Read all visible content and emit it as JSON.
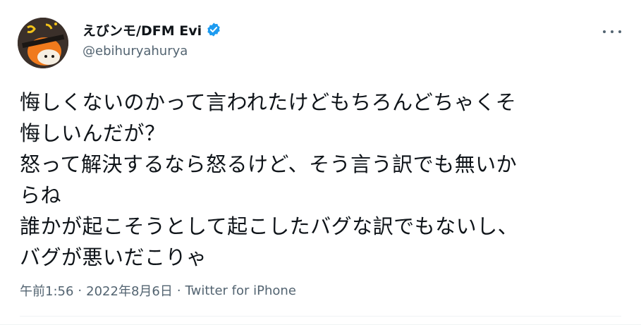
{
  "author": {
    "display_name": "えびンモ/DFM Evi",
    "handle": "@ebihuryahurya",
    "verified": true,
    "avatar_icon": "avatar-icon"
  },
  "tweet": {
    "lines": [
      "悔しくないのかって言われたけどもちろんどちゃくそ",
      "悔しいんだが？",
      "怒って解決するなら怒るけど、そう言う訳でも無いか",
      "らね",
      "誰かが起こそうとして起こしたバグな訳でもないし、",
      "バグが悪いだこりゃ"
    ]
  },
  "meta": {
    "time": "午前1:56",
    "separator": "·",
    "date": "2022年8月6日",
    "source": "Twitter for iPhone"
  },
  "colors": {
    "text_primary": "#0f1419",
    "text_secondary": "#536471",
    "verified_blue": "#1d9bf0",
    "divider": "#eff3f4"
  },
  "icons": {
    "more": "more-options-icon",
    "verified": "verified-badge-icon"
  }
}
